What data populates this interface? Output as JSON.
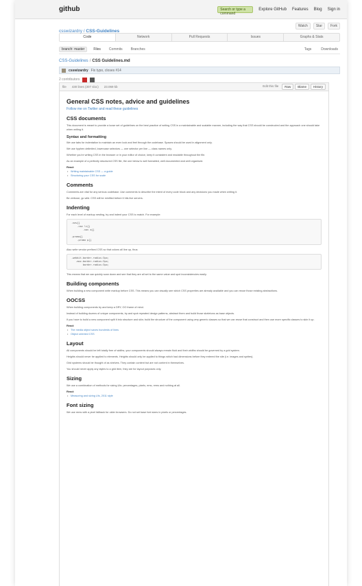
{
  "header": {
    "logo": "github",
    "search_label": "Search or type a command",
    "nav": [
      "Explore GitHub",
      "Features",
      "Blog",
      "Sign in"
    ]
  },
  "repo": {
    "owner": "csswizardry",
    "name": "CSS-Guidelines",
    "actions": [
      "Watch",
      "Star",
      "Fork"
    ]
  },
  "tabs": [
    "Code",
    "Network",
    "Pull Requests",
    "Issues",
    "Graphs & Stats"
  ],
  "subtabs": {
    "branch": "branch: master",
    "items": [
      "Files",
      "Commits",
      "Branches"
    ],
    "right": [
      "Tags",
      "Downloads"
    ]
  },
  "breadcrumb": {
    "root": "CSS-Guidelines",
    "file": "CSS Guidelines.md"
  },
  "commit": {
    "author": "csswizardry",
    "message": "Fix typo, closes #14"
  },
  "contributors": {
    "count": "2 contributors"
  },
  "file": {
    "meta": [
      "file",
      "430 lines (307 sloc)",
      "23.069 kb"
    ],
    "buttons": [
      "Edit this file",
      "Raw",
      "Blame",
      "History"
    ]
  },
  "doc": {
    "title": "General CSS notes, advice and guidelines",
    "intro": "Follow me on Twitter and read these guidelines",
    "s1_h": "CSS documents",
    "s1_p": "This document is meant to provide a loose set of guidelines on the best practice of writing CSS in a maintainable and scalable manner, including the way that CSS should be constructed and the approach one should take when writing it.",
    "s1_sub": "Syntax and formatting",
    "s1_p2": "We use tabs for indentation to maintain an even look and feel through the codebase. Spaces should be used in alignment only.",
    "s1_p3": "We use hyphen delimited, lowercase selectors — one selector per line — class names only.",
    "s1_p4": "Whether you're writing CSS in the browser or in your editor of choice, keep it consistent and readable throughout the file.",
    "s1_p5": "As an example of a perfectly structured CSS file, the one below is well formatted, well documented and well organised.",
    "read1": "Read:",
    "links1": [
      "Writing maintainable CSS — a guide",
      "Structuring your CSS for scale"
    ],
    "s2_h": "Comments",
    "s2_p": "Comments are vital for any serious codebase. Use comments to describe the intent of every code block and any decisions you made when writing it.",
    "s2_p2": "Be verbose, go wild. CSS will be minified before it hits live servers.",
    "s3_h": "Indenting",
    "s3_p": "For each level of markup nesting, try and indent your CSS to match. For example:",
    "code1": ".nav{}\n    .nav li{}\n        .nav a{}\n\n.promo{}\n    .promo p{}",
    "s3_p2": "Also write vendor prefixed CSS so that colons all line up, thus:",
    "code2": "-webkit-border-radius:3px;\n   -moz-border-radius:3px;\n        border-radius:3px;",
    "s3_p3": "This means that we can quickly scan down and see that they are all set to the same value and spot inconsistencies easily.",
    "s4_h": "Building components",
    "s4_p": "When building a new component write markup before CSS. This means you can visually see which CSS properties are already available and you can reuse those existing abstractions.",
    "s5_h": "OOCSS",
    "s5_p": "When building components try and keep a DRY, OO frame of mind.",
    "s5_p2": "Instead of building dozens of unique components, try and spot repeated design patterns, abstract them and build those skeletons as base objects.",
    "s5_p3": "If you have to build a new component split it into structure and skin; build the structure of the component using very generic classes so that we can reuse that construct and then use more specific classes to skin it up.",
    "read2": "Read:",
    "links2": [
      "The media object saves hundreds of lines",
      "Object oriented CSS"
    ],
    "s6_h": "Layout",
    "s6_p": "All components should be left totally free of widths; your components should always remain fluid and their widths should be governed by a grid system.",
    "s6_p2": "Heights should never be applied to elements. Heights should only be applied to things which had dimensions before they entered the site (i.e. images and sprites).",
    "s6_p3": "Grid systems should be thought of as shelves. They contain content but are not content in themselves.",
    "s6_p4": "You should never apply any styles to a grid item, they are for layout purposes only.",
    "s7_h": "Sizing",
    "s7_p": "We use a combination of methods for sizing UIs: percentages, pixels, ems, rems and nothing at all.",
    "read3": "Read:",
    "links3": [
      "Measuring and sizing UIs, 2011 style"
    ],
    "s8_h": "Font sizing",
    "s8_p": "We use rems with a pixel fallback for older browsers. Do not set base font sizes in pixels or percentages."
  }
}
